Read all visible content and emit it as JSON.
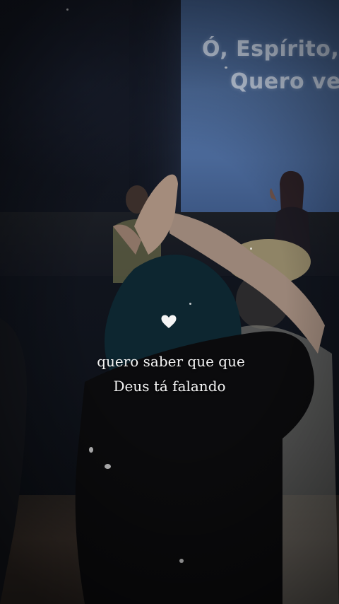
{
  "background": {
    "screen_text": [
      "Ó, Espírito,",
      "Quero ve"
    ],
    "colors": {
      "screen": "#4a6898",
      "background": "#10141d",
      "floor": "#3a302a"
    }
  },
  "overlay": {
    "icon": "white-heart-icon",
    "caption_lines": [
      "quero saber que que",
      "Deus tá falando"
    ],
    "text_color": "#f4f4f4"
  }
}
